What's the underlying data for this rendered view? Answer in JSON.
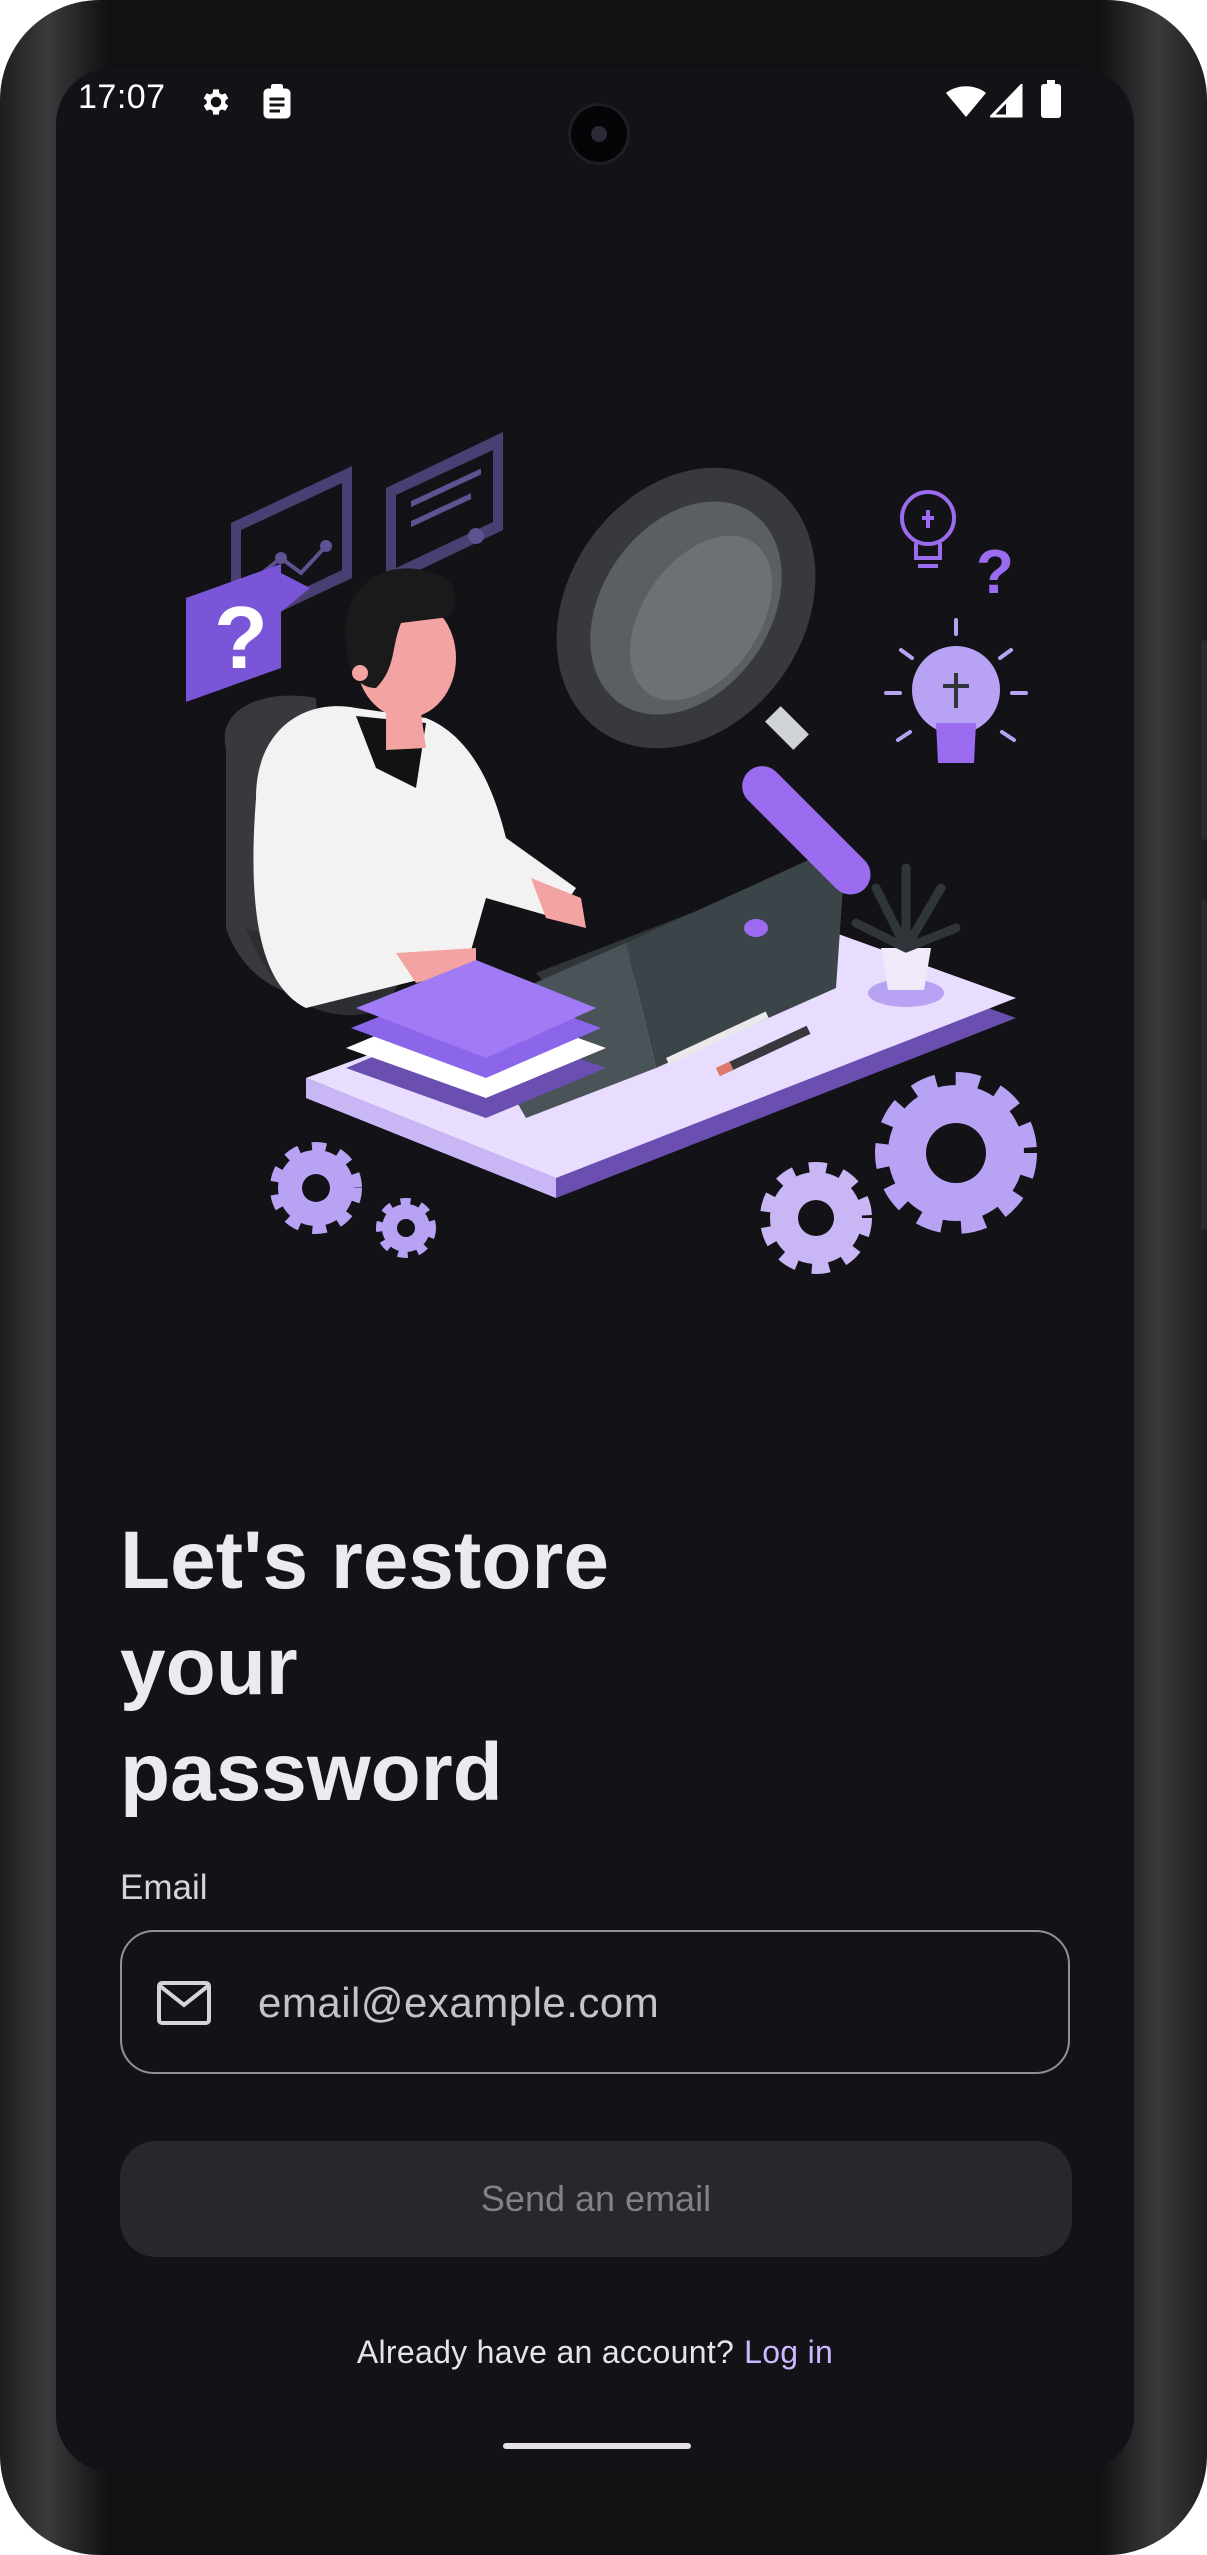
{
  "status_bar": {
    "time": "17:07",
    "icons": [
      "settings-icon",
      "clipboard-icon",
      "wifi-icon",
      "signal-icon",
      "battery-icon"
    ]
  },
  "illustration": {
    "question_mark": "?"
  },
  "restore": {
    "title_lines": [
      "Let's restore",
      "your",
      "password"
    ],
    "email_label": "Email",
    "email_placeholder": "email@example.com",
    "send_button": "Send an email",
    "footer_text": "Already have an account?",
    "login_link": "Log in"
  },
  "colors": {
    "background": "#131216",
    "accent": "#9b6bf0",
    "accent_light": "#cdb8ff",
    "button_disabled": "#28272c"
  }
}
